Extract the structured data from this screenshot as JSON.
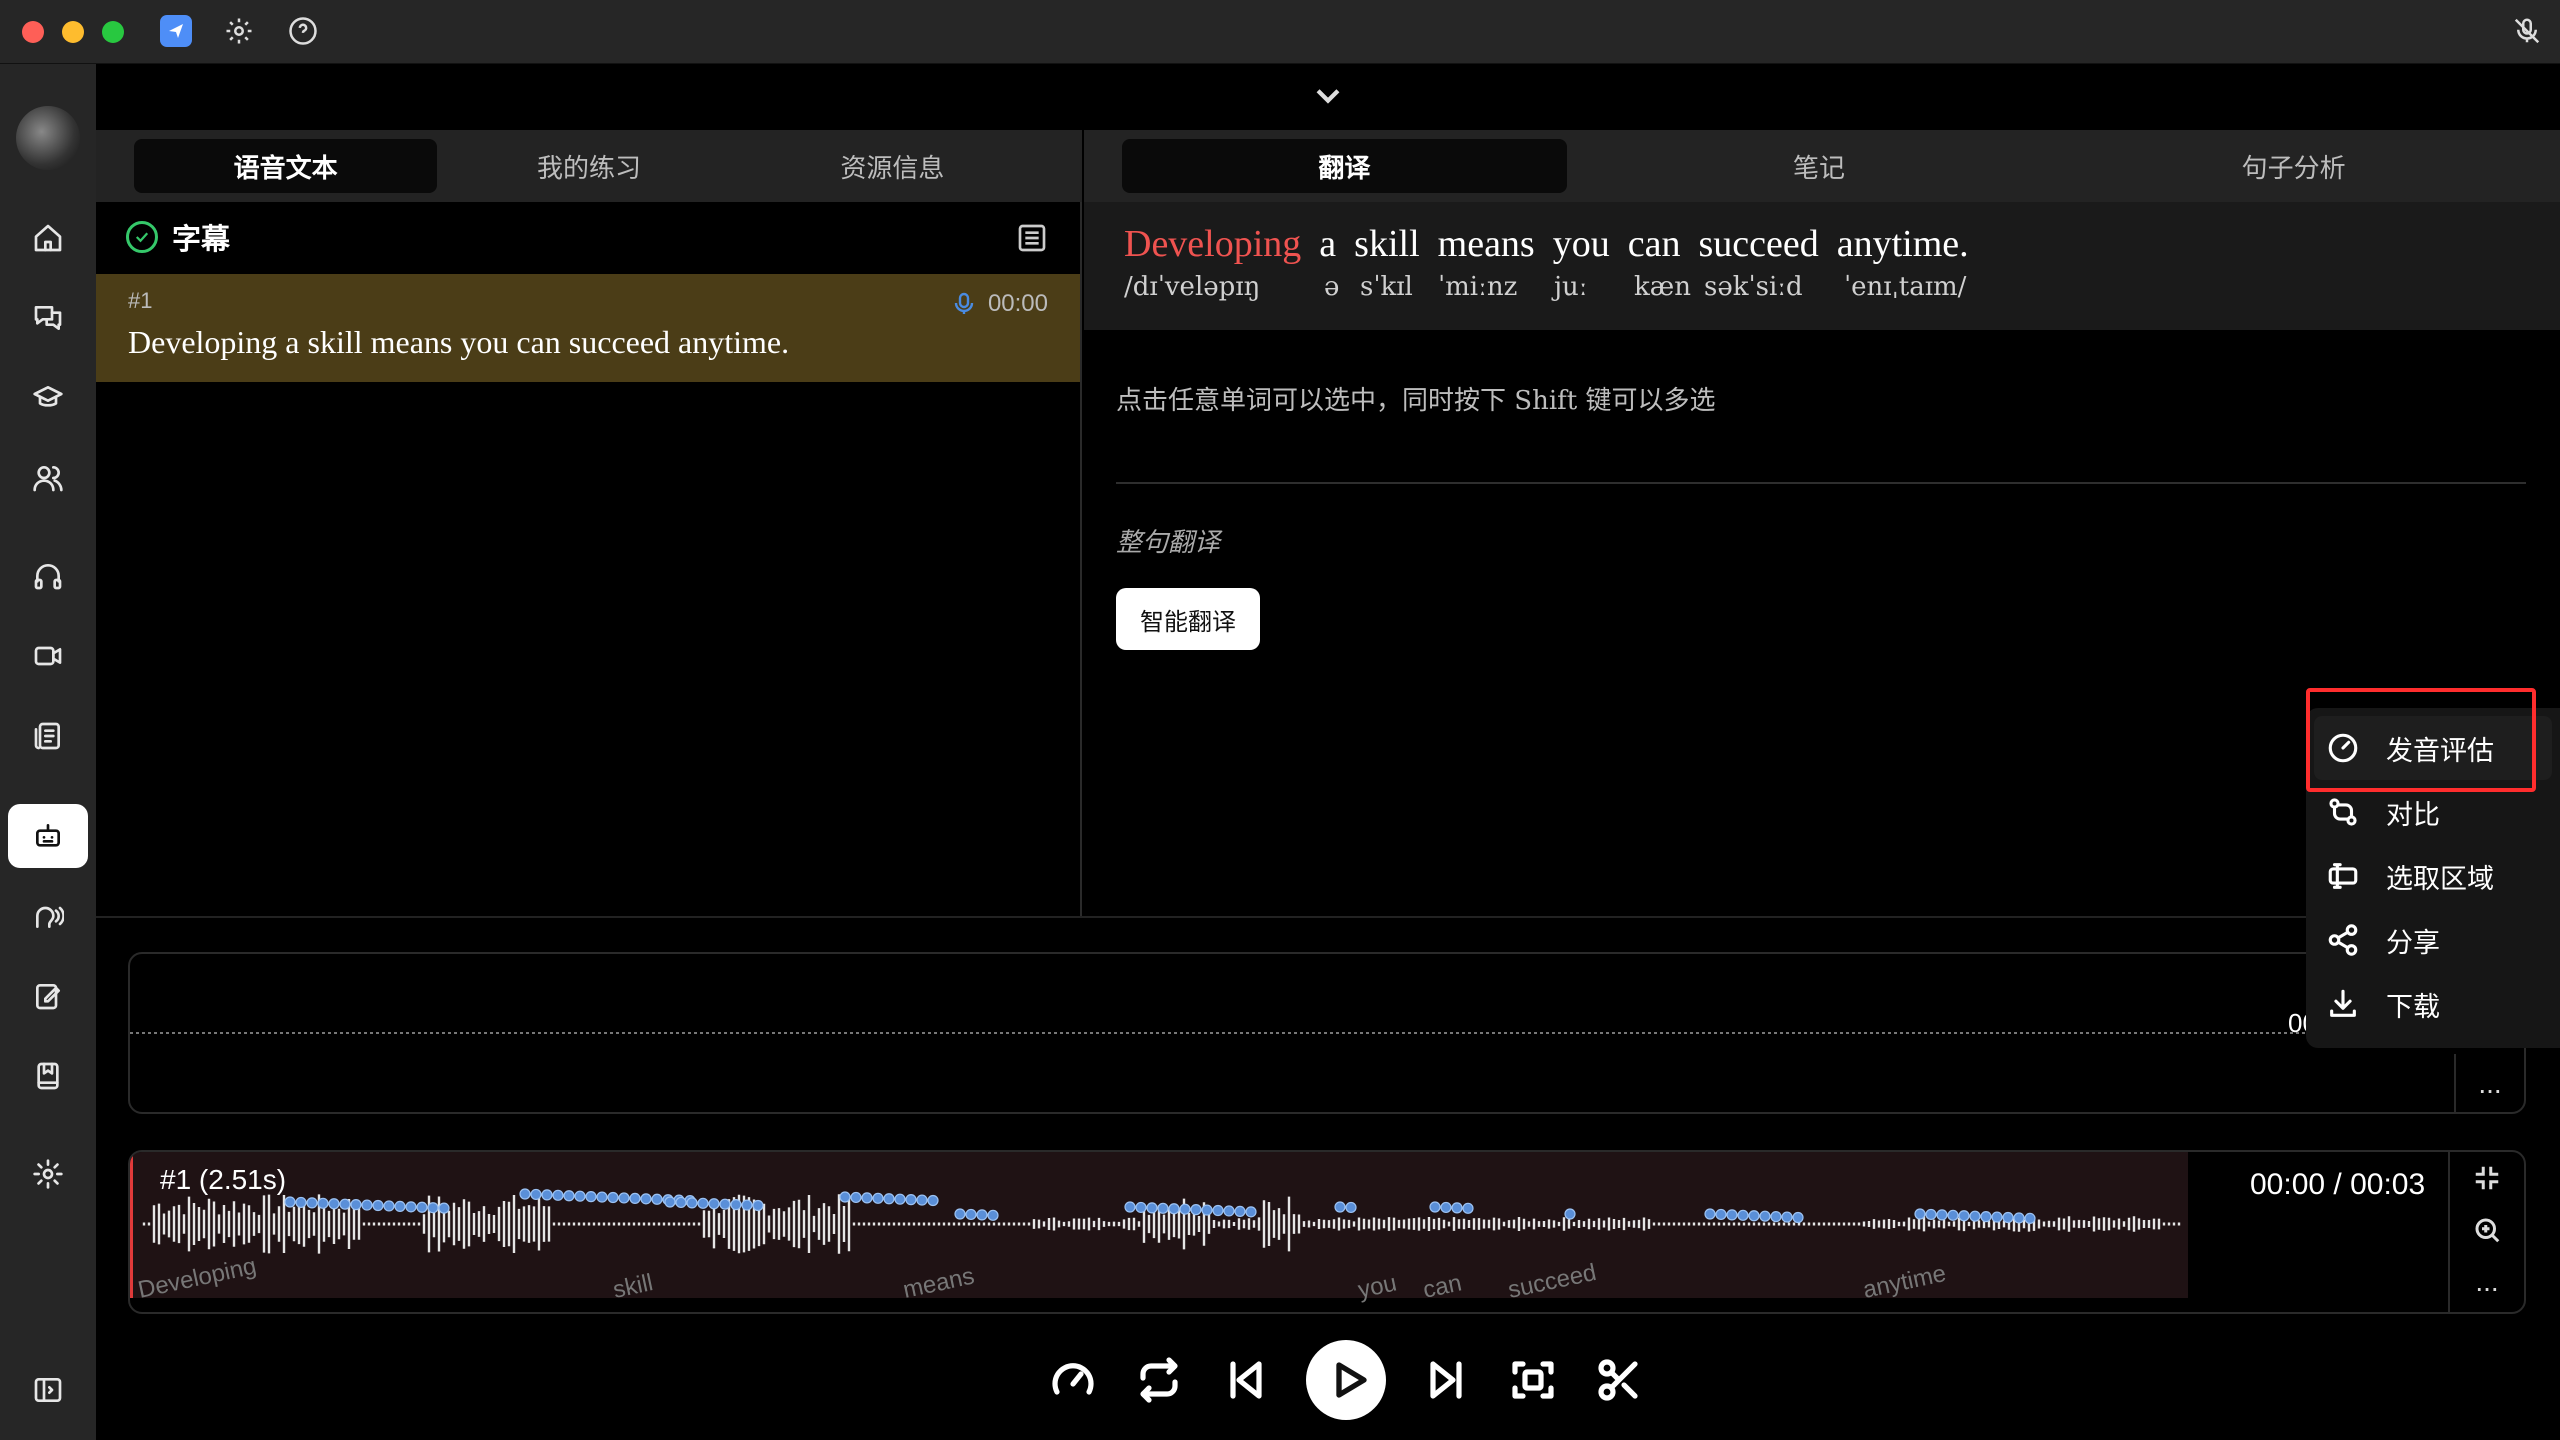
{
  "titlebar": {
    "icons": [
      "app-icon",
      "gear-icon",
      "help-icon",
      "mic-off-icon"
    ]
  },
  "sidebar": {
    "items": [
      "home",
      "chat",
      "learn",
      "users",
      "listen",
      "video",
      "notes",
      "robot",
      "speech",
      "edit",
      "book",
      "settings",
      "panel"
    ]
  },
  "tabs_left": [
    "语音文本",
    "我的练习",
    "资源信息"
  ],
  "tabs_right": [
    "翻译",
    "笔记",
    "句子分析"
  ],
  "subtitle_panel": {
    "title": "字幕",
    "item_number": "#1",
    "item_time": "00:00",
    "item_text": "Developing a skill means you can succeed anytime."
  },
  "translation": {
    "words": [
      "Developing",
      "a",
      "skill",
      "means",
      "you",
      "can",
      "succeed",
      "anytime."
    ],
    "phonetics": [
      "/dɪˈveləpɪŋ",
      "ə",
      "sˈkɪl",
      "ˈmiːnz",
      "juː",
      "kæn",
      "səkˈsiːd",
      "ˈenɪˌtaɪm/"
    ],
    "hint": "点击任意单词可以选中，同时按下 Shift 键可以多选",
    "section_label": "整句翻译",
    "translate_button": "智能翻译"
  },
  "waveform_top": {
    "time": "00:0",
    "more": "..."
  },
  "waveform_main": {
    "title": "#1 (2.51s)",
    "time": "00:00 / 00:03",
    "word_labels": [
      "Developing",
      "skill",
      "means",
      "you",
      "can",
      "succeed",
      "anytime"
    ],
    "more": "..."
  },
  "context_menu": {
    "items": [
      "发音评估",
      "对比",
      "选取区域",
      "分享",
      "下载"
    ]
  },
  "colors": {
    "accent_red": "#ef5350",
    "subtitle_highlight": "#4b3d17",
    "check_green": "#35c86a",
    "mic_blue": "#4a8be0"
  }
}
